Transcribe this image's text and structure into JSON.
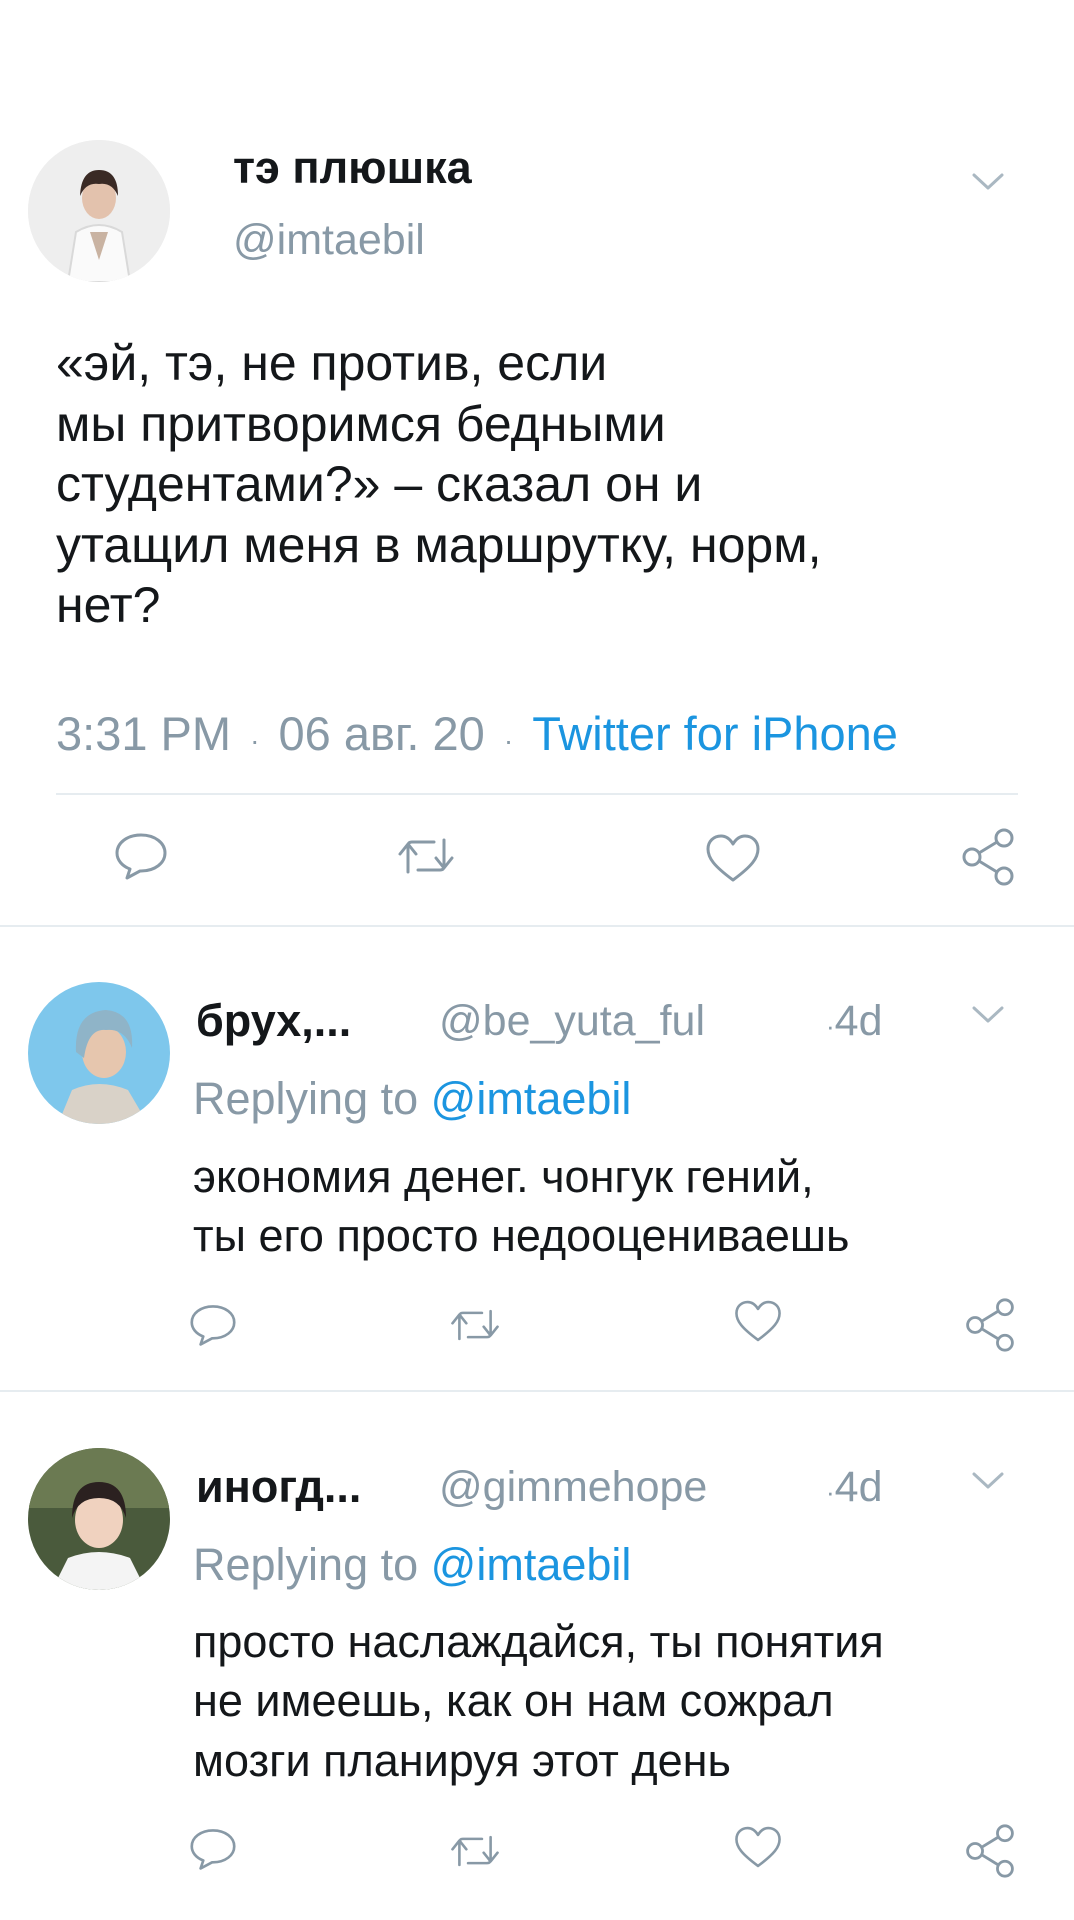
{
  "main_tweet": {
    "author_name": "тэ плюшка",
    "handle": "@imtaebil",
    "text": "«эй, тэ, не против, если\nмы притворимся бедными\nстудентами?» – сказал он и\nутащил меня в маршрутку, норм,\nнет?",
    "time": "3:31 PM",
    "date": "06 авг. 20",
    "source": "Twitter for iPhone",
    "dot": "·"
  },
  "replies": [
    {
      "author_name": "брух,...",
      "handle": "@be_yuta_ful",
      "age": "4d",
      "dot": "·",
      "replying_prefix": "Replying to",
      "replying_to": "@imtaebil",
      "text": "экономия денег. чонгук гений,\nты его просто недооцениваешь"
    },
    {
      "author_name": "иногд...",
      "handle": "@gimmehope",
      "age": "4d",
      "dot": "·",
      "replying_prefix": "Replying to",
      "replying_to": "@imtaebil",
      "text": "просто наслаждайся, ты понятия\nне имеешь, как он нам сожрал\nмозги планируя этот день"
    }
  ],
  "icons": {
    "reply": "reply-icon",
    "retweet": "retweet-icon",
    "like": "like-icon",
    "share": "share-icon",
    "more": "chevron-down-icon"
  },
  "colors": {
    "text": "#14171a",
    "muted": "#8899a6",
    "link": "#1b95e0",
    "separator": "#e6ecf0"
  }
}
